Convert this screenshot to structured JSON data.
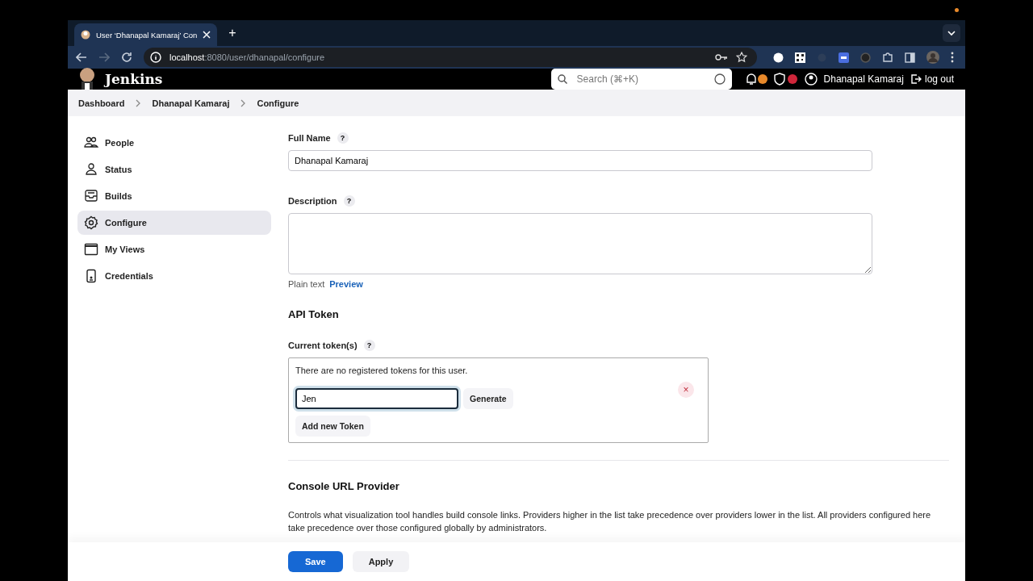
{
  "browser": {
    "tab_title": "User ‘Dhanapal Kamaraj’ Con",
    "new_tab": "+",
    "url_host": "localhost",
    "url_path": ":8080/user/dhanapal/configure"
  },
  "header": {
    "logo": "Jenkins",
    "search_placeholder": "Search (⌘+K)",
    "user": "Dhanapal Kamaraj",
    "logout": "log out"
  },
  "breadcrumbs": [
    "Dashboard",
    "Dhanapal Kamaraj",
    "Configure"
  ],
  "sidebar": {
    "items": [
      {
        "label": "People",
        "selected": false
      },
      {
        "label": "Status",
        "selected": false
      },
      {
        "label": "Builds",
        "selected": false
      },
      {
        "label": "Configure",
        "selected": true
      },
      {
        "label": "My Views",
        "selected": false
      },
      {
        "label": "Credentials",
        "selected": false
      }
    ]
  },
  "form": {
    "full_name": {
      "label": "Full Name",
      "help": "?",
      "value": "Dhanapal Kamaraj"
    },
    "description": {
      "label": "Description",
      "help": "?",
      "format": "Plain text",
      "preview": "Preview"
    },
    "api_token": {
      "title": "API Token",
      "label": "Current token(s)",
      "help": "?",
      "empty_message": "There are no registered tokens for this user.",
      "new_token_value": "Jen",
      "generate": "Generate",
      "remove": "×",
      "add": "Add new Token"
    },
    "console": {
      "title": "Console URL Provider",
      "text": "Controls what visualization tool handles build console links. Providers higher in the list take precedence over providers lower in the list. All providers configured here take precedence over those configured globally by administrators."
    }
  },
  "actions": [
    {
      "label": "Save",
      "kind": "primary"
    },
    {
      "label": "Apply",
      "kind": "secondary"
    }
  ]
}
